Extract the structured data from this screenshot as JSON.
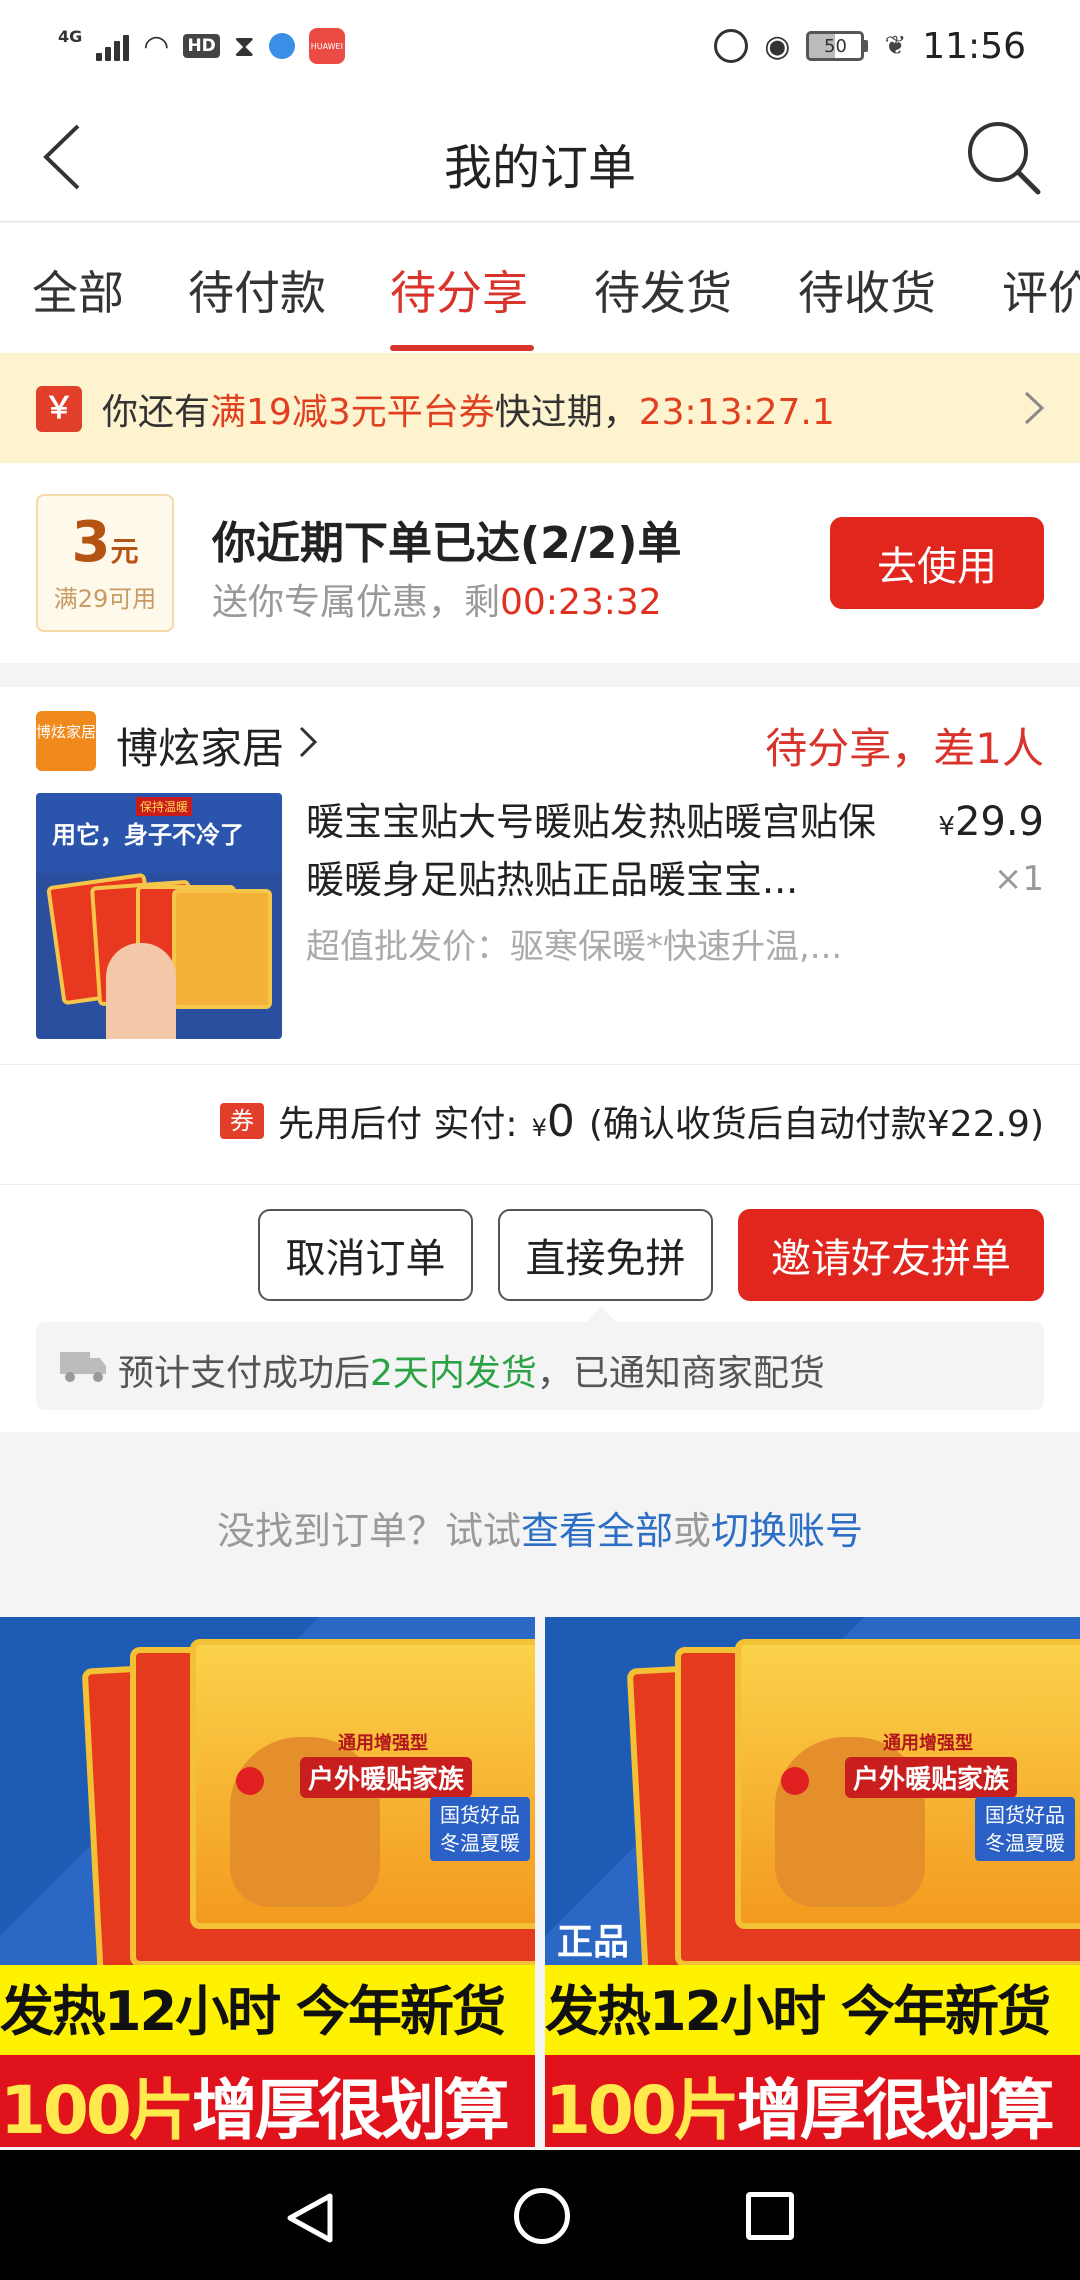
{
  "status_bar": {
    "network": "4G",
    "hd": "HD",
    "battery": "50",
    "time": "11:56",
    "app_icon_text": "HUAWEI"
  },
  "header": {
    "title": "我的订单"
  },
  "tabs": [
    {
      "label": "全部"
    },
    {
      "label": "待付款"
    },
    {
      "label": "待分享",
      "active": true
    },
    {
      "label": "待发货"
    },
    {
      "label": "待收货"
    },
    {
      "label": "评价"
    }
  ],
  "banner": {
    "icon_text": "￥",
    "prefix": "你还有",
    "coupon": "满19减3元平台券",
    "middle": "快过期，",
    "countdown": "23:13:27.1"
  },
  "coupon_card": {
    "amount": "3",
    "unit": "元",
    "condition": "满29可用",
    "title": "你近期下单已达(2/2)单",
    "subtitle": "送你专属优惠，剩",
    "countdown": "00:23:32",
    "button": "去使用"
  },
  "order": {
    "shop_logo_text": "博炫家居",
    "shop_name": "博炫家居",
    "status": "待分享，差1人",
    "product": {
      "image_badge": "保持温暖",
      "image_slogan": "用它，身子不冷了",
      "title": "暖宝宝贴大号暖贴发热贴暖宫贴保暖暖身足贴热贴正品暖宝宝...",
      "currency": "¥",
      "price": "29.9",
      "quantity": "×1",
      "desc": "超值批发价：驱寒保暖*快速升温,..."
    },
    "payment": {
      "icon_text": "券",
      "label": "先用后付 实付:",
      "currency": "¥",
      "amount": "0",
      "note": "(确认收货后自动付款¥22.9)"
    },
    "buttons": {
      "cancel": "取消订单",
      "direct": "直接免拼",
      "invite": "邀请好友拼单"
    },
    "shipping": {
      "prefix": "预计支付成功后",
      "highlight": "2天内发货",
      "suffix": "，已通知商家配货"
    }
  },
  "not_found": {
    "prefix": "没找到订单？试试",
    "link_all": "查看全部",
    "or": "或",
    "link_switch": "切换账号"
  },
  "recommendations": [
    {
      "tag_top": "通用增强型",
      "tag_main": "户外暖贴家族",
      "tag_side": "国货好品\n冬温夏暖",
      "stamp": "",
      "line1": "发热12小时 今年新货",
      "line2_num": "100片",
      "line2_text": "增厚很划算"
    },
    {
      "tag_top": "通用增强型",
      "tag_main": "户外暖贴家族",
      "tag_side": "国货好品\n冬温夏暖",
      "stamp": "正品",
      "line1": "发热12小时 今年新货",
      "line2_num": "100片",
      "line2_text": "增厚很划算"
    }
  ],
  "colors": {
    "accent_red": "#e0261d",
    "tab_active": "#d9342b",
    "banner_bg": "#fdf3cf",
    "link_blue": "#2c6fc4",
    "ship_green": "#2ba245"
  }
}
